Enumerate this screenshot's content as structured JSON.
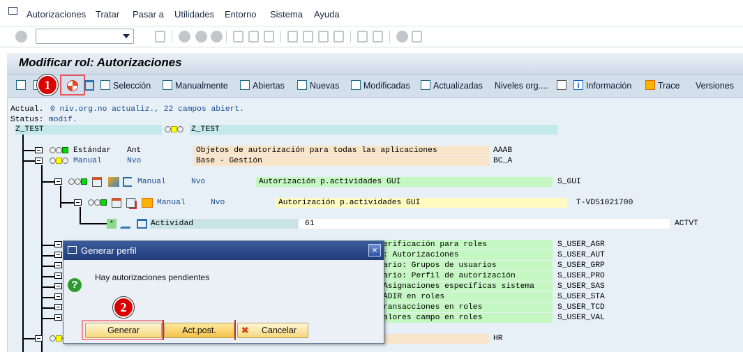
{
  "menu": [
    "Autorizaciones",
    "Tratar",
    "Pasar a",
    "Utilidades",
    "Entorno",
    "Sistema",
    "Ayuda"
  ],
  "title": "Modificar rol: Autorizaciones",
  "toolbar": {
    "seleccion": "Selección",
    "manualmente": "Manualmente",
    "abiertas": "Abiertas",
    "nuevas": "Nuevas",
    "modificadas": "Modificadas",
    "actualizadas": "Actualizadas",
    "niveles": "Niveles org....",
    "informacion": "Información",
    "trace": "Trace",
    "versiones": "Versiones"
  },
  "status": {
    "line1_label": "Actual.",
    "line1_value": "0 niv.org.no actualiz., 22 campos abiert.",
    "line2_label": "Status:",
    "line2_value": "modif."
  },
  "tree": {
    "root": {
      "name": "Z_TEST",
      "text": "Z_TEST"
    },
    "estandar": {
      "label": "Estándar",
      "state": "Ant",
      "text": "Objetos de autorización para todas las aplicaciones",
      "code": "AAAB"
    },
    "manual": {
      "label": "Manual",
      "state": "Nvo",
      "text": "Base - Gestión",
      "code": "BC_A"
    },
    "sgui": {
      "label": "Manual",
      "state": "Nvo",
      "text": "Autorización p.actividades GUI",
      "code": "S_GUI"
    },
    "tvd": {
      "label": "Manual",
      "state": "Nvo",
      "text": "Autorización p.actividades GUI",
      "code": "T-VD51021700"
    },
    "field": {
      "label": "Actividad",
      "value": "61",
      "code": "ACTVT"
    },
    "rows": [
      {
        "text": "erificación para roles",
        "code": "S_USER_AGR"
      },
      {
        "text": ": Autorizaciones",
        "code": "S_USER_AUT"
      },
      {
        "text": "ario: Grupos de usuarios",
        "code": "S_USER_GRP"
      },
      {
        "text": "ario: Perfil de autorización",
        "code": "S_USER_PRO"
      },
      {
        "text": "Asignaciones específicas sistema",
        "code": "S_USER_SAS"
      },
      {
        "text": "ADIR en roles",
        "code": "S_USER_STA"
      },
      {
        "text": "ransacciones en roles",
        "code": "S_USER_TCD"
      },
      {
        "text": "alores campo en roles",
        "code": "S_USER_VAL"
      }
    ],
    "hr": {
      "code": "HR"
    }
  },
  "dialog": {
    "title": "Generar perfil",
    "message": "Hay autorizaciones pendientes",
    "generar": "Generar",
    "actpost": "Act.post.",
    "cancelar": "Cancelar"
  },
  "badges": {
    "one": "1",
    "two": "2"
  },
  "colors": {
    "root_bar": "#c3e9ec",
    "orange_bar": "#f8e4c9",
    "green_bar": "#c4f7c2",
    "yellow_bar": "#fffac0",
    "field_bar": "#c9e2e3",
    "highlight": "#e8555a"
  }
}
